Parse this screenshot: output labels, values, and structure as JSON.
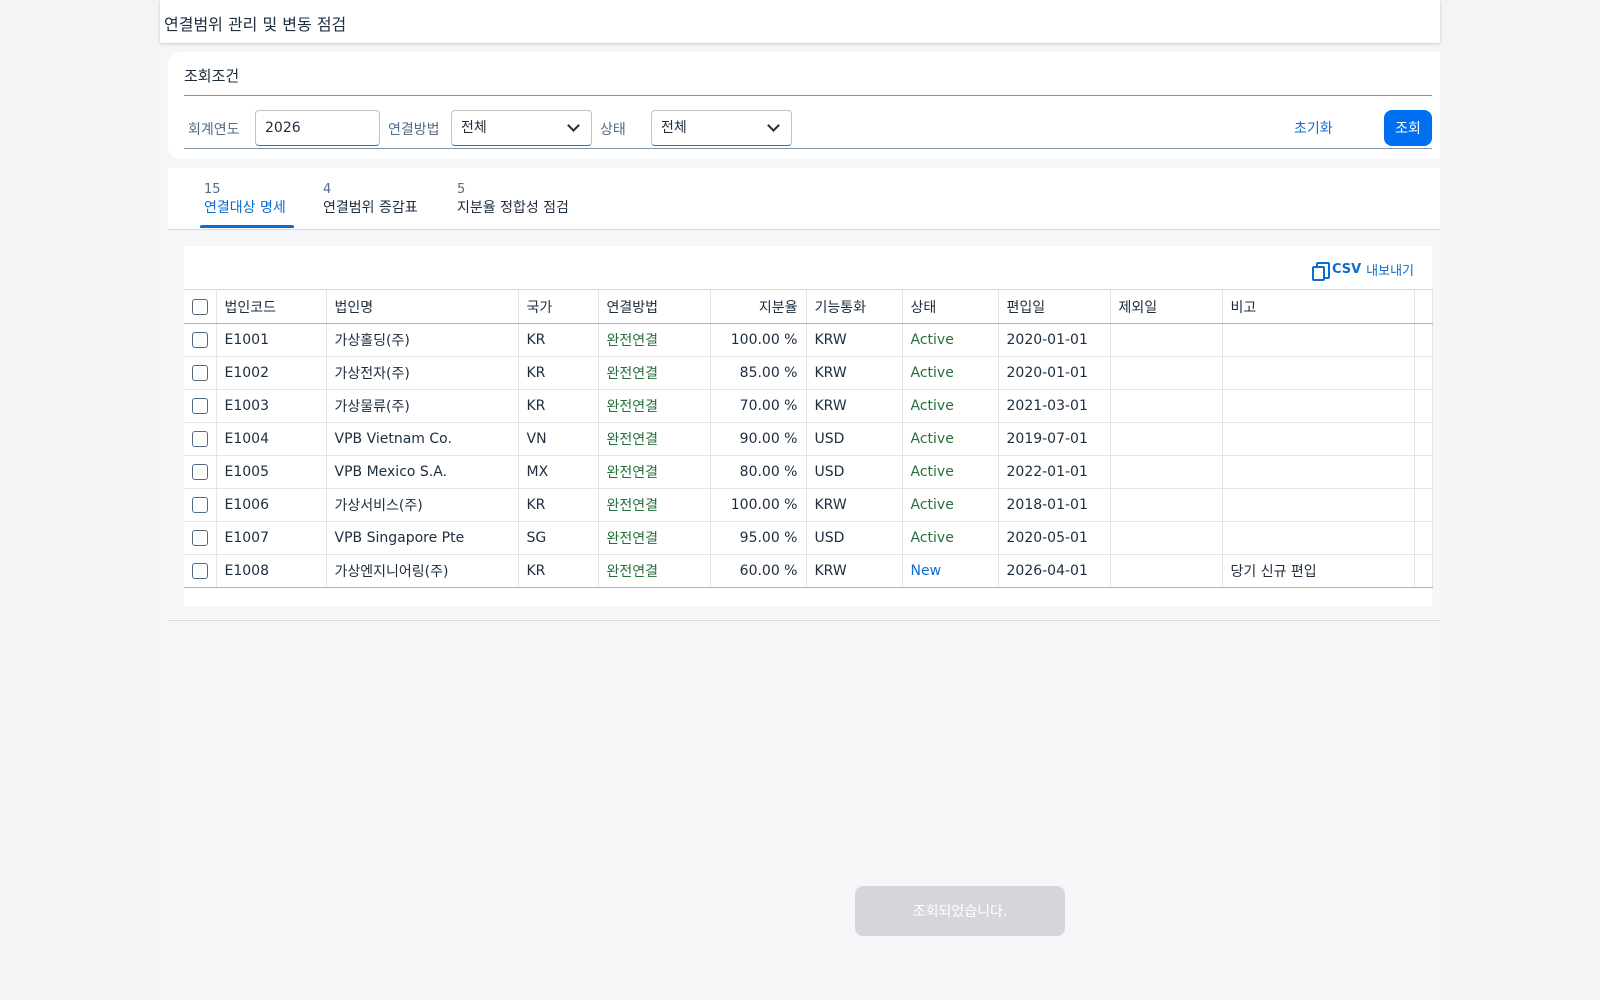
{
  "page": {
    "title": "연결범위 관리 및 변동 점검"
  },
  "filters": {
    "title": "조회조건",
    "fiscal_year_label": "회계연도",
    "fiscal_year_value": "2026",
    "method_label": "연결방법",
    "method_value": "전체",
    "status_label": "상태",
    "status_value": "전체",
    "reset_label": "초기화",
    "search_label": "조회"
  },
  "tabs": [
    {
      "count": "15",
      "label": "연결대상 명세",
      "active": true
    },
    {
      "count": "4",
      "label": "연결범위 증감표",
      "active": false
    },
    {
      "count": "5",
      "label": "지분율 정합성 점검",
      "active": false
    }
  ],
  "toolbar": {
    "csv_word": "CSV",
    "csv_rest": "내보내기"
  },
  "table": {
    "columns": [
      "법인코드",
      "법인명",
      "국가",
      "연결방법",
      "지분율",
      "기능통화",
      "상태",
      "편입일",
      "제외일",
      "비고"
    ],
    "rows": [
      [
        "E1001",
        "가상홀딩(주)",
        "KR",
        "완전연결",
        "100.00 %",
        "KRW",
        "Active",
        "2020-01-01",
        "",
        ""
      ],
      [
        "E1002",
        "가상전자(주)",
        "KR",
        "완전연결",
        "85.00 %",
        "KRW",
        "Active",
        "2020-01-01",
        "",
        ""
      ],
      [
        "E1003",
        "가상물류(주)",
        "KR",
        "완전연결",
        "70.00 %",
        "KRW",
        "Active",
        "2021-03-01",
        "",
        ""
      ],
      [
        "E1004",
        "VPB Vietnam Co.",
        "VN",
        "완전연결",
        "90.00 %",
        "USD",
        "Active",
        "2019-07-01",
        "",
        ""
      ],
      [
        "E1005",
        "VPB Mexico S.A.",
        "MX",
        "완전연결",
        "80.00 %",
        "USD",
        "Active",
        "2022-01-01",
        "",
        ""
      ],
      [
        "E1006",
        "가상서비스(주)",
        "KR",
        "완전연결",
        "100.00 %",
        "KRW",
        "Active",
        "2018-01-01",
        "",
        ""
      ],
      [
        "E1007",
        "VPB Singapore Pte",
        "SG",
        "완전연결",
        "95.00 %",
        "USD",
        "Active",
        "2020-05-01",
        "",
        ""
      ],
      [
        "E1008",
        "가상엔지니어링(주)",
        "KR",
        "완전연결",
        "60.00 %",
        "KRW",
        "New",
        "2026-04-01",
        "",
        "당기 신규 편입"
      ]
    ]
  },
  "toast": {
    "message": "조회되었습니다."
  },
  "colors": {
    "accent": "#0a6ed1",
    "primary_button": "#0070f2",
    "status_green": "#256f3a"
  }
}
